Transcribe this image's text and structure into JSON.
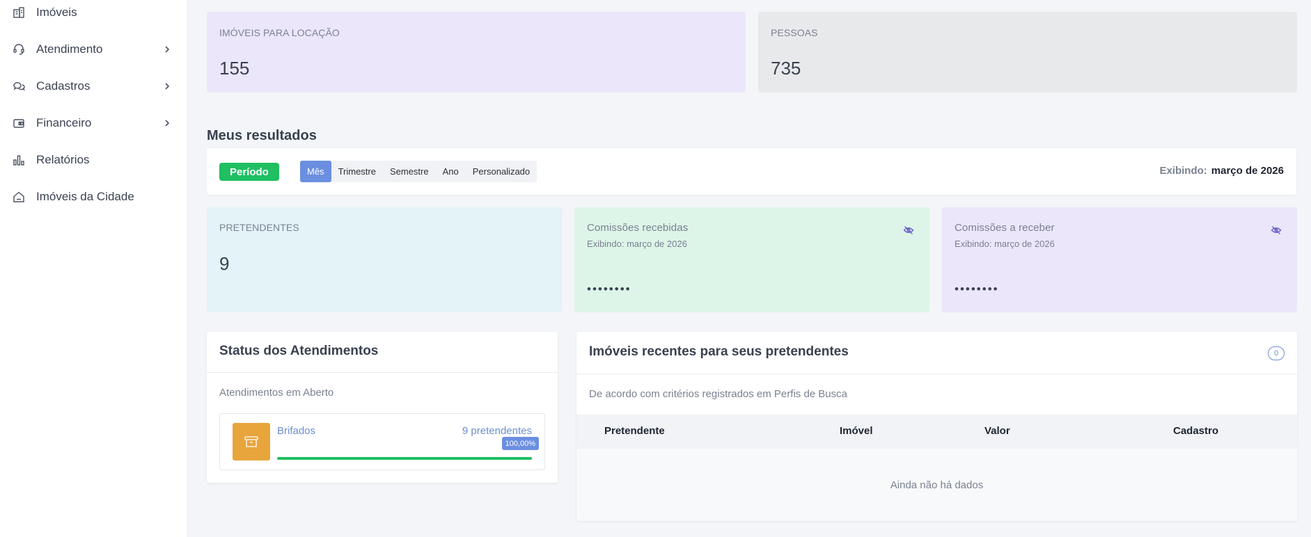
{
  "sidebar": {
    "items": [
      {
        "label": "Imóveis",
        "icon": "building-icon",
        "has_submenu": false
      },
      {
        "label": "Atendimento",
        "icon": "headset-icon",
        "has_submenu": true
      },
      {
        "label": "Cadastros",
        "icon": "chat-bubbles-icon",
        "has_submenu": true
      },
      {
        "label": "Financeiro",
        "icon": "wallet-icon",
        "has_submenu": true
      },
      {
        "label": "Relatórios",
        "icon": "bar-chart-icon",
        "has_submenu": false
      },
      {
        "label": "Imóveis da Cidade",
        "icon": "home-icon",
        "has_submenu": false
      }
    ]
  },
  "top_stats": {
    "rental": {
      "label": "IMÓVEIS PARA LOCAÇÃO",
      "value": "155",
      "color": "#ebe6f9"
    },
    "people": {
      "label": "PESSOAS",
      "value": "735",
      "color": "#e8e9eb"
    }
  },
  "results": {
    "title": "Meus resultados",
    "period_badge": "Período",
    "period_options": [
      "Mês",
      "Trimestre",
      "Semestre",
      "Ano",
      "Personalizado"
    ],
    "selected_period": "Mês",
    "showing_label": "Exibindo:",
    "showing_value": "março de 2026"
  },
  "metrics": {
    "candidates": {
      "label": "PRETENDENTES",
      "value": "9",
      "color": "#e3f3f8"
    },
    "received": {
      "label": "Comissões recebidas",
      "sub": "Exibindo: março de 2026",
      "value": "••••••••",
      "color": "#ddf5e8"
    },
    "to_receive": {
      "label": "Comissões a receber",
      "sub": "Exibindo: março de 2026",
      "value": "••••••••",
      "color": "#ebe6f9"
    }
  },
  "status_panel": {
    "title": "Status dos Atendimentos",
    "subtitle": "Atendimentos em Aberto",
    "stage": {
      "name": "Brifados",
      "count": "9 pretendentes",
      "percent_label": "100,00%",
      "progress": 1.0,
      "icon": "archive-icon"
    }
  },
  "recent_panel": {
    "title": "Imóveis recentes para seus pretendentes",
    "count": "0",
    "subtitle": "De acordo com critérios registrados em Perfis de Busca",
    "columns": [
      "Pretendente",
      "Imóvel",
      "Valor",
      "Cadastro"
    ],
    "empty_text": "Ainda não há dados"
  },
  "colors": {
    "accent": "#6b8fe0",
    "success": "#1fbf62",
    "warning": "#e8a53c"
  }
}
